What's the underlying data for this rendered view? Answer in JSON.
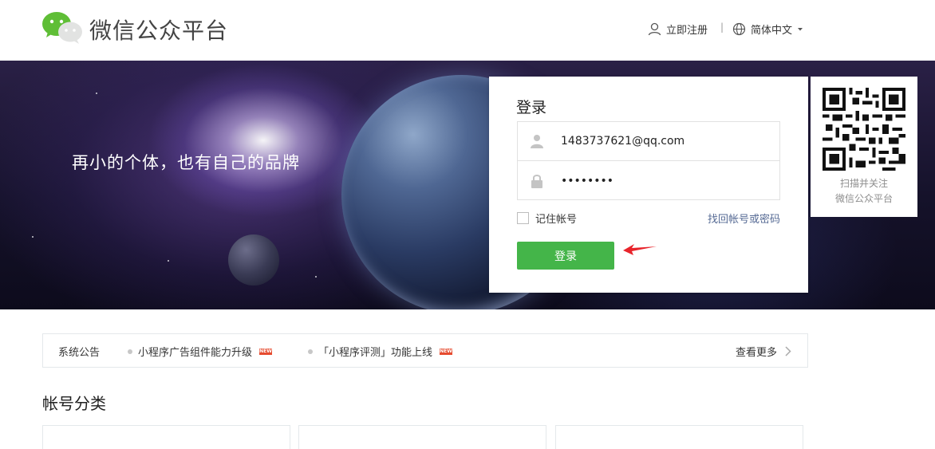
{
  "header": {
    "brand": "微信公众平台",
    "register": "立即注册",
    "separator": "|",
    "language": "简体中文"
  },
  "banner": {
    "slogan": "再小的个体，也有自己的品牌"
  },
  "login": {
    "title": "登录",
    "account_value": "1483737621@qq.com",
    "password_value": "••••••••",
    "remember_label": "记住帐号",
    "forgot_link": "找回帐号或密码",
    "submit_label": "登录"
  },
  "qr": {
    "line1": "扫描并关注",
    "line2": "微信公众平台"
  },
  "notice": {
    "title": "系统公告",
    "items": [
      {
        "text": "小程序广告组件能力升级",
        "badge": "NEW"
      },
      {
        "text": "「小程序评测」功能上线",
        "badge": "NEW"
      }
    ],
    "more": "查看更多"
  },
  "categories": {
    "title": "帐号分类"
  },
  "colors": {
    "primary_green": "#44b549",
    "link_blue": "#576b95",
    "badge_red": "#e64c30",
    "arrow_red": "#e8242b"
  }
}
